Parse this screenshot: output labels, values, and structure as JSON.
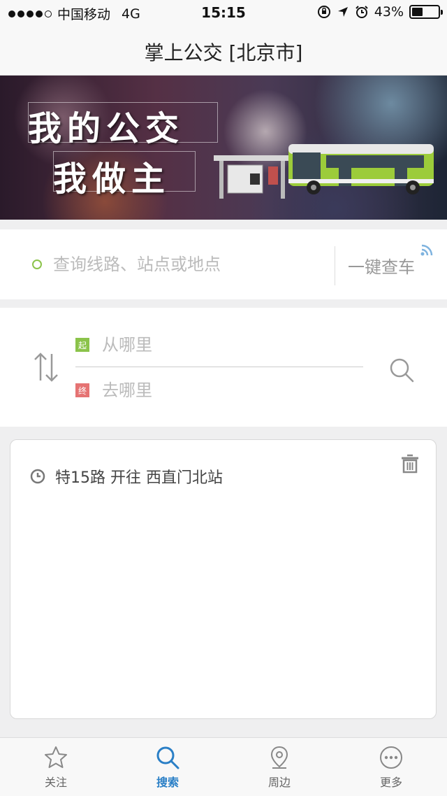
{
  "status_bar": {
    "carrier": "中国移动",
    "network": "4G",
    "time": "15:15",
    "battery": "43%",
    "battery_level": 0.43
  },
  "nav": {
    "title": "掌上公交 [北京市]"
  },
  "banner": {
    "slogan_line1": "我的公交",
    "slogan_line2": "我做主"
  },
  "search": {
    "placeholder": "查询线路、站点或地点",
    "one_key_label": "一键查车"
  },
  "route": {
    "from_tag": "起",
    "from_placeholder": "从哪里",
    "to_tag": "终",
    "to_placeholder": "去哪里"
  },
  "history": {
    "items": [
      {
        "text": "特15路  开往  西直门北站"
      }
    ]
  },
  "tabs": [
    {
      "label": "关注",
      "icon": "star-icon"
    },
    {
      "label": "搜索",
      "icon": "search-icon"
    },
    {
      "label": "周边",
      "icon": "location-pin-icon"
    },
    {
      "label": "更多",
      "icon": "more-icon"
    }
  ],
  "colors": {
    "accent": "#2a7fc6",
    "from_green": "#8bc34a",
    "to_red": "#e57373"
  }
}
